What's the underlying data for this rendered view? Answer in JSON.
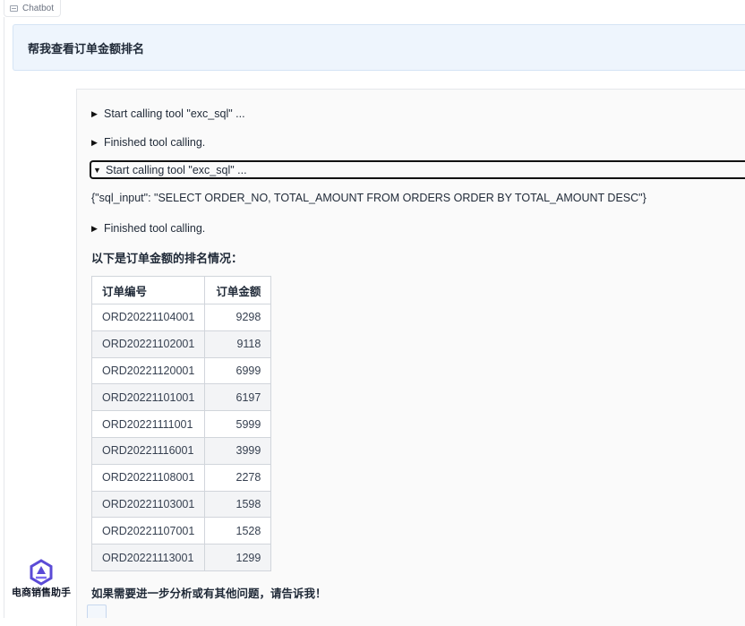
{
  "tab": {
    "label": "Chatbot",
    "icon": "chat-icon"
  },
  "user_message": {
    "text": "帮我查看订单金额排名"
  },
  "bot": {
    "avatar_icon": "assistant-logo-icon",
    "name": "电商销售助手",
    "steps": [
      {
        "state": "collapsed",
        "arrow": "▶",
        "text": "Start calling tool \"exc_sql\" ..."
      },
      {
        "state": "collapsed",
        "arrow": "▶",
        "text": "Finished tool calling."
      },
      {
        "state": "expanded",
        "arrow": "▼",
        "text": "Start calling tool \"exc_sql\" ..."
      },
      {
        "state": "collapsed",
        "arrow": "▶",
        "text": "Finished tool calling."
      }
    ],
    "tool_input": "{\"sql_input\": \"SELECT ORDER_NO, TOTAL_AMOUNT FROM ORDERS ORDER BY TOTAL_AMOUNT DESC\"}",
    "intro": "以下是订单金额的排名情况：",
    "table": {
      "headers": [
        "订单编号",
        "订单金额"
      ],
      "rows": [
        [
          "ORD20221104001",
          "9298"
        ],
        [
          "ORD20221102001",
          "9118"
        ],
        [
          "ORD20221120001",
          "6999"
        ],
        [
          "ORD20221101001",
          "6197"
        ],
        [
          "ORD20221111001",
          "5999"
        ],
        [
          "ORD20221116001",
          "3999"
        ],
        [
          "ORD20221108001",
          "2278"
        ],
        [
          "ORD20221103001",
          "1598"
        ],
        [
          "ORD20221107001",
          "1528"
        ],
        [
          "ORD20221113001",
          "1299"
        ]
      ]
    },
    "outro": "如果需要进一步分析或有其他问题，请告诉我！"
  },
  "colors": {
    "accent": "#5b4bd6",
    "user_bubble_bg": "#eef5fd",
    "row_alt_bg": "#f3f4f6"
  }
}
